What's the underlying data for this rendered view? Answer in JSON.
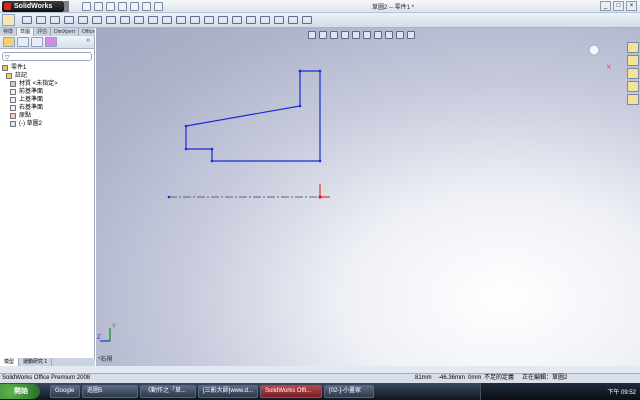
{
  "app": {
    "logo_text": "SolidWorks",
    "window_title": "草圖2 -- 零件1 *"
  },
  "command_tabs": [
    "特徵",
    "草圖",
    "評估",
    "DimXpert",
    "Office 產品"
  ],
  "feature_panel": {
    "tree": [
      "零件1",
      "註記",
      "材質 <未指定>",
      "前基準面",
      "上基準面",
      "右基準面",
      "原點",
      "(-) 草圖2"
    ],
    "bottom_tabs": [
      "模型",
      "運動研究 1"
    ]
  },
  "viewport": {
    "view_label": "*右視",
    "axis_y": "Y",
    "axis_z": "Z"
  },
  "sketch": {
    "line_color": "#1a2bd6",
    "centerline_color": "#334466",
    "origin_color": "#d61a1a"
  },
  "statusbar": {
    "product": "SolidWorks Office Premium 2008",
    "x": "81mm",
    "y": "-46.36mm",
    "z": "0mm",
    "state": "不足的定義",
    "editing": "正在編輯：草圖2"
  },
  "taskbar": {
    "start_label": "開始",
    "google": "Google",
    "tasks": [
      "巡圖5",
      "《動作之「草...",
      "[三影大師]www.d...",
      "SolidWorks Offi...",
      "[02-]-小畫家"
    ],
    "clock": "下午 09:52"
  }
}
